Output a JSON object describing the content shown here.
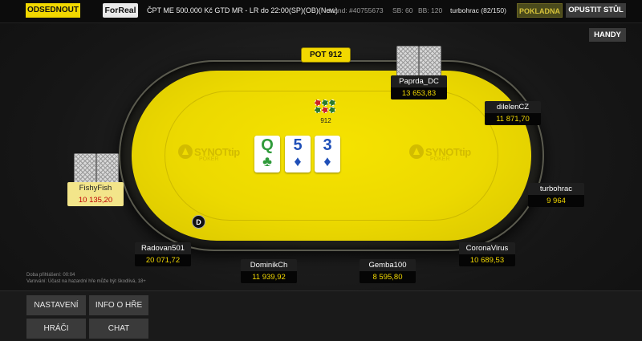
{
  "topbar": {
    "sit_out": "ODSEDNOUT",
    "mode_badge": "ForReal",
    "tournament_title": "ČPT ME 500.000 Kč GTD MR - LR do 22:00(SP)(OB)(New)",
    "hand": "Hand: #40755673",
    "small_blind": "SB: 60",
    "big_blind": "BB: 120",
    "user": "turbohrac (82/150)",
    "cashier": "POKLADNA",
    "leave_table": "OPUSTIT STŮL"
  },
  "handy_button": "HANDY",
  "table": {
    "pot_label": "POT 912",
    "pot_amount": "912",
    "brand_name": "SYNOTtip",
    "brand_sub": "POKER",
    "dealer_button": "D",
    "board": [
      {
        "rank": "Q",
        "suit": "♣",
        "suit_name": "clubs"
      },
      {
        "rank": "5",
        "suit": "♦",
        "suit_name": "diamonds"
      },
      {
        "rank": "3",
        "suit": "♦",
        "suit_name": "diamonds"
      }
    ]
  },
  "players": [
    {
      "name": "Paprda_DC",
      "stack": "13 653,83"
    },
    {
      "name": "dilelenCZ",
      "stack": "11 871,70"
    },
    {
      "name": "turbohrac",
      "stack": "9 964"
    },
    {
      "name": "CoronaVirus",
      "stack": "10 689,53"
    },
    {
      "name": "Gemba100",
      "stack": "8 595,80"
    },
    {
      "name": "DominikCh",
      "stack": "11 939,92"
    },
    {
      "name": "Radovan501",
      "stack": "20 071,72"
    },
    {
      "name": "FishyFish",
      "stack": "10 135,20"
    }
  ],
  "notes": {
    "login_time": "Doba přihlášení:  00:04",
    "warning": "Varování: Účast na hazardní hře může být škodlivá, 18+"
  },
  "bottom_menu": {
    "settings": "NASTAVENÍ",
    "game_info": "INFO O HŘE",
    "players": "HRÁČI",
    "chat": "CHAT"
  },
  "colors": {
    "accent_yellow": "#f2d800",
    "felt": "#ecd900",
    "stack_text": "#f2d800",
    "active_stack_text": "#c00000"
  }
}
